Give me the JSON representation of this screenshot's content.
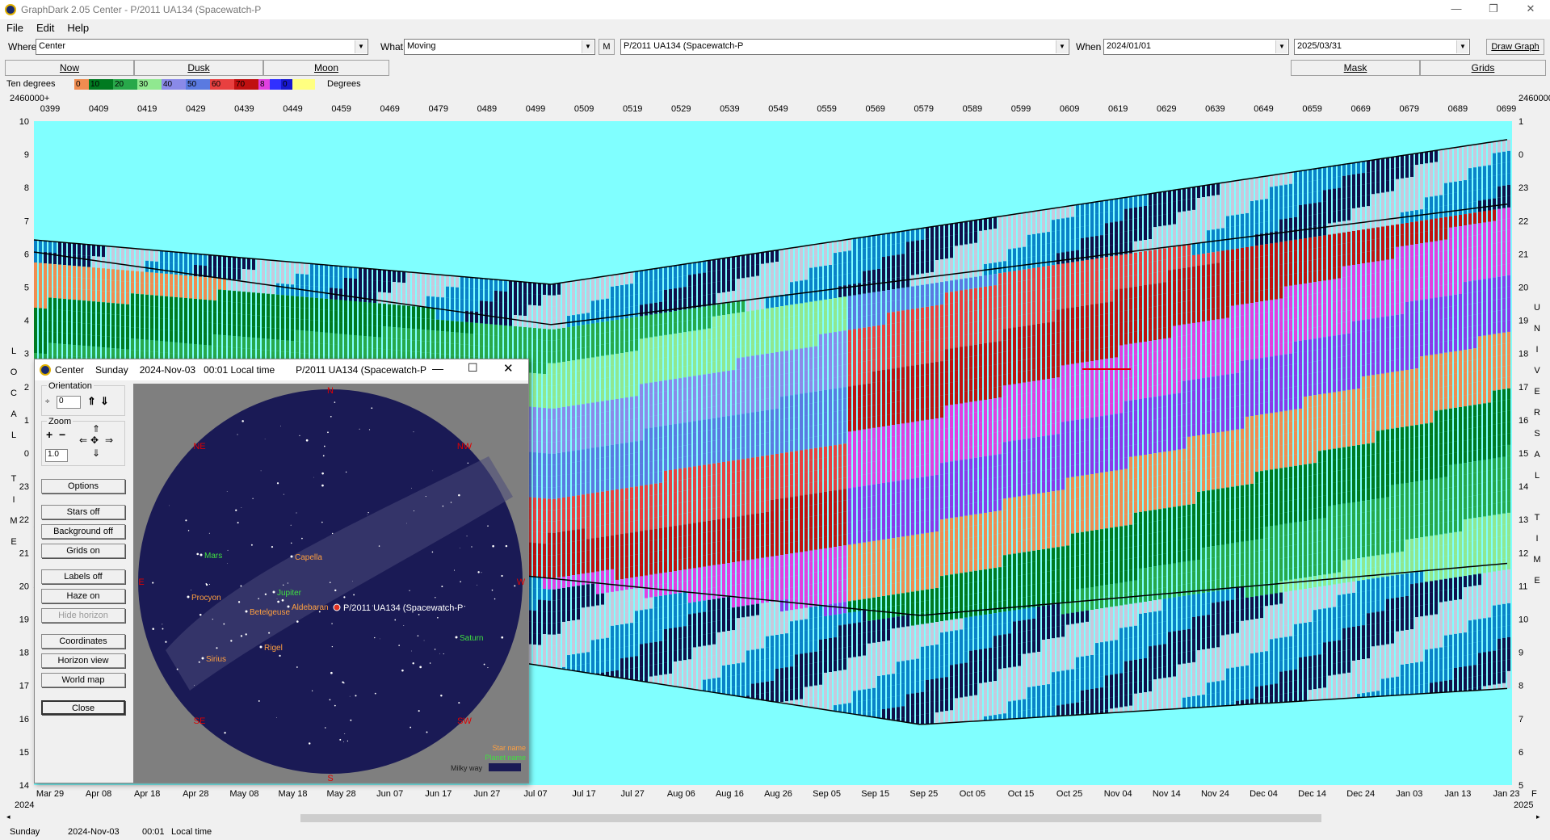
{
  "window": {
    "title": "GraphDark 2.05  Center  -  P/2011 UA134 (Spacewatch-P",
    "minimize": "—",
    "restore": "❐",
    "close": "✕"
  },
  "menu": [
    "File",
    "Edit",
    "Help"
  ],
  "toolbar": {
    "where_label": "Where",
    "where_value": "Center",
    "what_label": "What",
    "what_value": "Moving",
    "m_button": "M",
    "object_value": "P/2011 UA134 (Spacewatch-P",
    "when_label": "When",
    "when_from": "2024/01/01",
    "when_to": "2025/03/31",
    "draw_graph": "Draw Graph"
  },
  "tabs": {
    "now": "Now",
    "dusk": "Dusk",
    "moon": "Moon",
    "mask": "Mask",
    "grids": "Grids"
  },
  "legend": {
    "label": "Ten degrees",
    "unit": "Degrees",
    "cells": [
      {
        "text": "0",
        "color": "#f08c50"
      },
      {
        "text": "10",
        "color": "#007a20"
      },
      {
        "text": "20",
        "color": "#28a84a"
      },
      {
        "text": "30",
        "color": "#90e890"
      },
      {
        "text": "40",
        "color": "#8a8ae8"
      },
      {
        "text": "50",
        "color": "#5a7ae0"
      },
      {
        "text": "60",
        "color": "#e84040"
      },
      {
        "text": "70",
        "color": "#c01010"
      },
      {
        "text": "8",
        "color": "#e040e0"
      },
      {
        "text": "",
        "color": "#3030ff"
      },
      {
        "text": "0",
        "color": "#1818d0"
      },
      {
        "text": "",
        "color": "#ffff80"
      }
    ]
  },
  "axes": {
    "jd_prefix": "2460000+",
    "jd_ticks": [
      "0399",
      "0409",
      "0419",
      "0429",
      "0439",
      "0449",
      "0459",
      "0469",
      "0479",
      "0489",
      "0499",
      "0509",
      "0519",
      "0529",
      "0539",
      "0549",
      "0559",
      "0569",
      "0579",
      "0589",
      "0599",
      "0609",
      "0619",
      "0629",
      "0639",
      "0649",
      "0659",
      "0669",
      "0679",
      "0689",
      "0699"
    ],
    "date_ticks": [
      "Mar 29",
      "Apr 08",
      "Apr 18",
      "Apr 28",
      "May 08",
      "May 18",
      "May 28",
      "Jun 07",
      "Jun 17",
      "Jun 27",
      "Jul 07",
      "Jul 17",
      "Jul 27",
      "Aug 06",
      "Aug 16",
      "Aug 26",
      "Sep 05",
      "Sep 15",
      "Sep 25",
      "Oct 05",
      "Oct 15",
      "Oct 25",
      "Nov 04",
      "Nov 14",
      "Nov 24",
      "Dec 04",
      "Dec 14",
      "Dec 24",
      "Jan 03",
      "Jan 13",
      "Jan 23"
    ],
    "year_start": "2024",
    "year_end": "2025",
    "right_tail": "F",
    "left_hours": [
      "10",
      "9",
      "8",
      "7",
      "6",
      "5",
      "4",
      "3",
      "2",
      "1",
      "0",
      "23",
      "22",
      "21",
      "20",
      "19",
      "18",
      "17",
      "16",
      "15",
      "14"
    ],
    "right_hours": [
      "1",
      "0",
      "23",
      "22",
      "21",
      "20",
      "19",
      "18",
      "17",
      "16",
      "15",
      "14",
      "13",
      "12",
      "11",
      "10",
      "9",
      "8",
      "7",
      "6",
      "5"
    ],
    "left_vertical_a": [
      "L",
      "O",
      "C",
      "A",
      "L"
    ],
    "left_vertical_b": [
      "T",
      "I",
      "M",
      "E"
    ],
    "right_vertical_a": [
      "U",
      "N",
      "I",
      "V",
      "E",
      "R",
      "S",
      "A",
      "L"
    ],
    "right_vertical_b": [
      "T",
      "I",
      "M",
      "E"
    ]
  },
  "popup": {
    "title_app": "Center",
    "title_day": "Sunday",
    "title_date": "2024-Nov-03",
    "title_time": "00:01 Local time",
    "title_object": "P/2011 UA134 (Spacewatch-P",
    "orientation_label": "Orientation",
    "orientation_value": "0",
    "zoom_label": "Zoom",
    "zoom_value": "1.0",
    "buttons": [
      "Options",
      "Stars off",
      "Background off",
      "Grids on",
      "Labels off",
      "Haze on",
      "Hide horizon",
      "Coordinates",
      "Horizon view",
      "World map",
      "Close"
    ],
    "compass": {
      "n": "N",
      "ne": "NE",
      "nw": "NW",
      "e": "E",
      "w": "W",
      "se": "SE",
      "sw": "SW",
      "s": "S"
    },
    "objects": [
      {
        "name": "Mars",
        "kind": "planet"
      },
      {
        "name": "Capella",
        "kind": "star"
      },
      {
        "name": "Jupiter",
        "kind": "planet"
      },
      {
        "name": "Procyon",
        "kind": "star"
      },
      {
        "name": "Aldebaran",
        "kind": "star"
      },
      {
        "name": "P/2011 UA134 (Spacewatch-P",
        "kind": "target"
      },
      {
        "name": "Betelgeuse",
        "kind": "star"
      },
      {
        "name": "Saturn",
        "kind": "planet"
      },
      {
        "name": "Rigel",
        "kind": "star"
      },
      {
        "name": "Sirius",
        "kind": "star"
      }
    ],
    "key": {
      "star": "Star name",
      "planet": "Planet name",
      "milky": "Milky way"
    }
  },
  "status": {
    "day": "Sunday",
    "date": "2024-Nov-03",
    "time": "00:01",
    "tz": "Local time"
  },
  "colors": {
    "sky": "#80ffff",
    "night": "#0f0f4a",
    "light": "#c8c8dc",
    "blue": "#0a82c8"
  }
}
